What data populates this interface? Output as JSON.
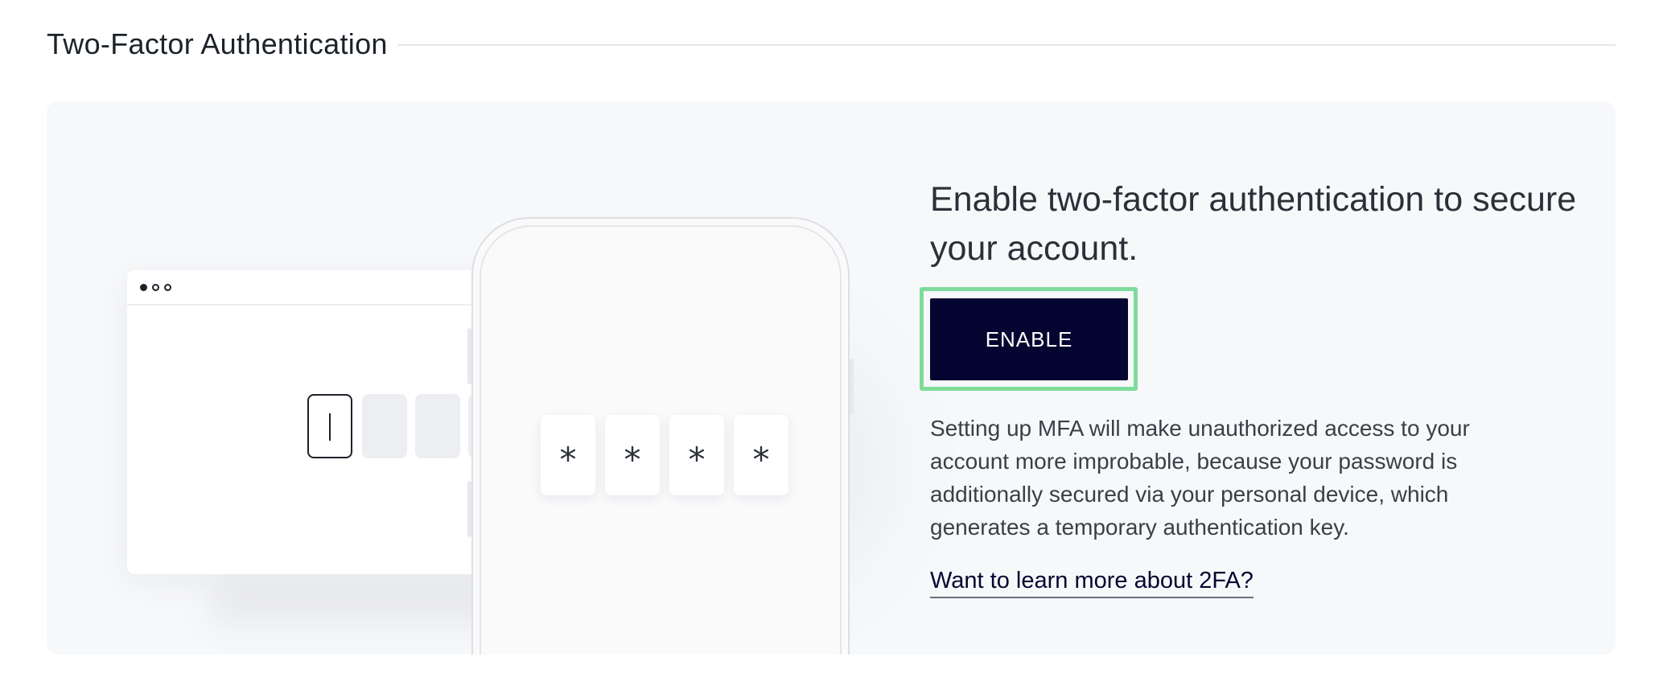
{
  "section": {
    "title": "Two-Factor Authentication"
  },
  "illustration": {
    "browser_dots": [
      "filled",
      "hollow",
      "hollow"
    ],
    "otp_boxes": [
      "active",
      "empty",
      "empty",
      "empty"
    ],
    "phone_code_chars": [
      "*",
      "*",
      "*",
      "*"
    ]
  },
  "content": {
    "heading": "Enable two-factor authentication to secure your account.",
    "enable_button_label": "ENABLE",
    "description": "Setting up MFA will make unauthorized access to your account more improbable, because your password is additionally secured via your personal device, which generates a temporary authentication key.",
    "learn_more_link": "Want to learn more about 2FA?"
  },
  "colors": {
    "primary_button": "#050531",
    "focus_ring": "#7edc9a",
    "card_background": "#f7f8fa"
  }
}
